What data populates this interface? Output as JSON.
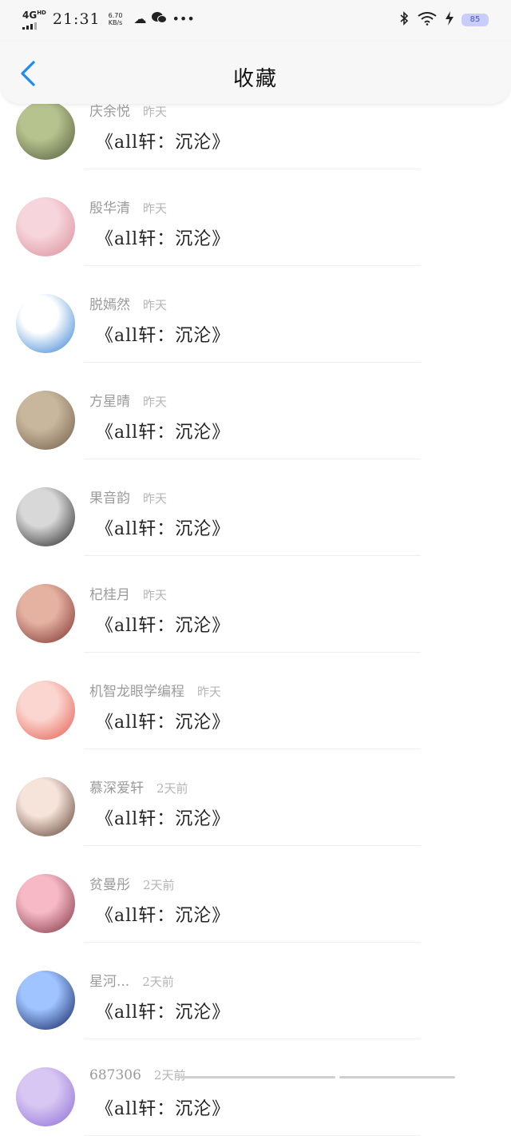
{
  "status": {
    "network": "4G",
    "network_sup": "HD",
    "time": "21:31",
    "speed_value": "6.70",
    "speed_unit": "KB/s",
    "battery": "85"
  },
  "header": {
    "title": "收藏"
  },
  "items": [
    {
      "user": "庆余悦",
      "time": "昨天",
      "title": "《all轩：沉沦》",
      "avatar_colors": [
        "#b7c38f",
        "#4f5a38"
      ]
    },
    {
      "user": "殷华清",
      "time": "昨天",
      "title": "《all轩：沉沦》",
      "avatar_colors": [
        "#f7d5dc",
        "#d98b98"
      ]
    },
    {
      "user": "脱嫣然",
      "time": "昨天",
      "title": "《all轩：沉沦》",
      "avatar_colors": [
        "#ffffff",
        "#2b7bd0"
      ]
    },
    {
      "user": "方星晴",
      "time": "昨天",
      "title": "《all轩：沉沦》",
      "avatar_colors": [
        "#c9b79d",
        "#6e5b47"
      ]
    },
    {
      "user": "果音韵",
      "time": "昨天",
      "title": "《all轩：沉沦》",
      "avatar_colors": [
        "#d8d8d8",
        "#1e1e1e"
      ]
    },
    {
      "user": "杞桂月",
      "time": "昨天",
      "title": "《all轩：沉沦》",
      "avatar_colors": [
        "#e5b2a2",
        "#7a2e2a"
      ]
    },
    {
      "user": "机智龙眼学编程",
      "time": "昨天",
      "title": "《all轩：沉沦》",
      "avatar_colors": [
        "#fbd6d0",
        "#e4574a"
      ]
    },
    {
      "user": "慕深爱轩",
      "time": "2天前",
      "title": "《all轩：沉沦》",
      "avatar_colors": [
        "#f6e4da",
        "#5a3a2c"
      ]
    },
    {
      "user": "贫曼彤",
      "time": "2天前",
      "title": "《all轩：沉沦》",
      "avatar_colors": [
        "#f7b9c6",
        "#7b2e3c"
      ]
    },
    {
      "user": "星河...",
      "time": "2天前",
      "title": "《all轩：沉沦》",
      "avatar_colors": [
        "#9fc4ff",
        "#0a1a5a"
      ]
    },
    {
      "user": "687306",
      "time": "2天前",
      "title": "《all轩：沉沦》",
      "avatar_colors": [
        "#d8c7f2",
        "#8a6ad6"
      ]
    }
  ]
}
